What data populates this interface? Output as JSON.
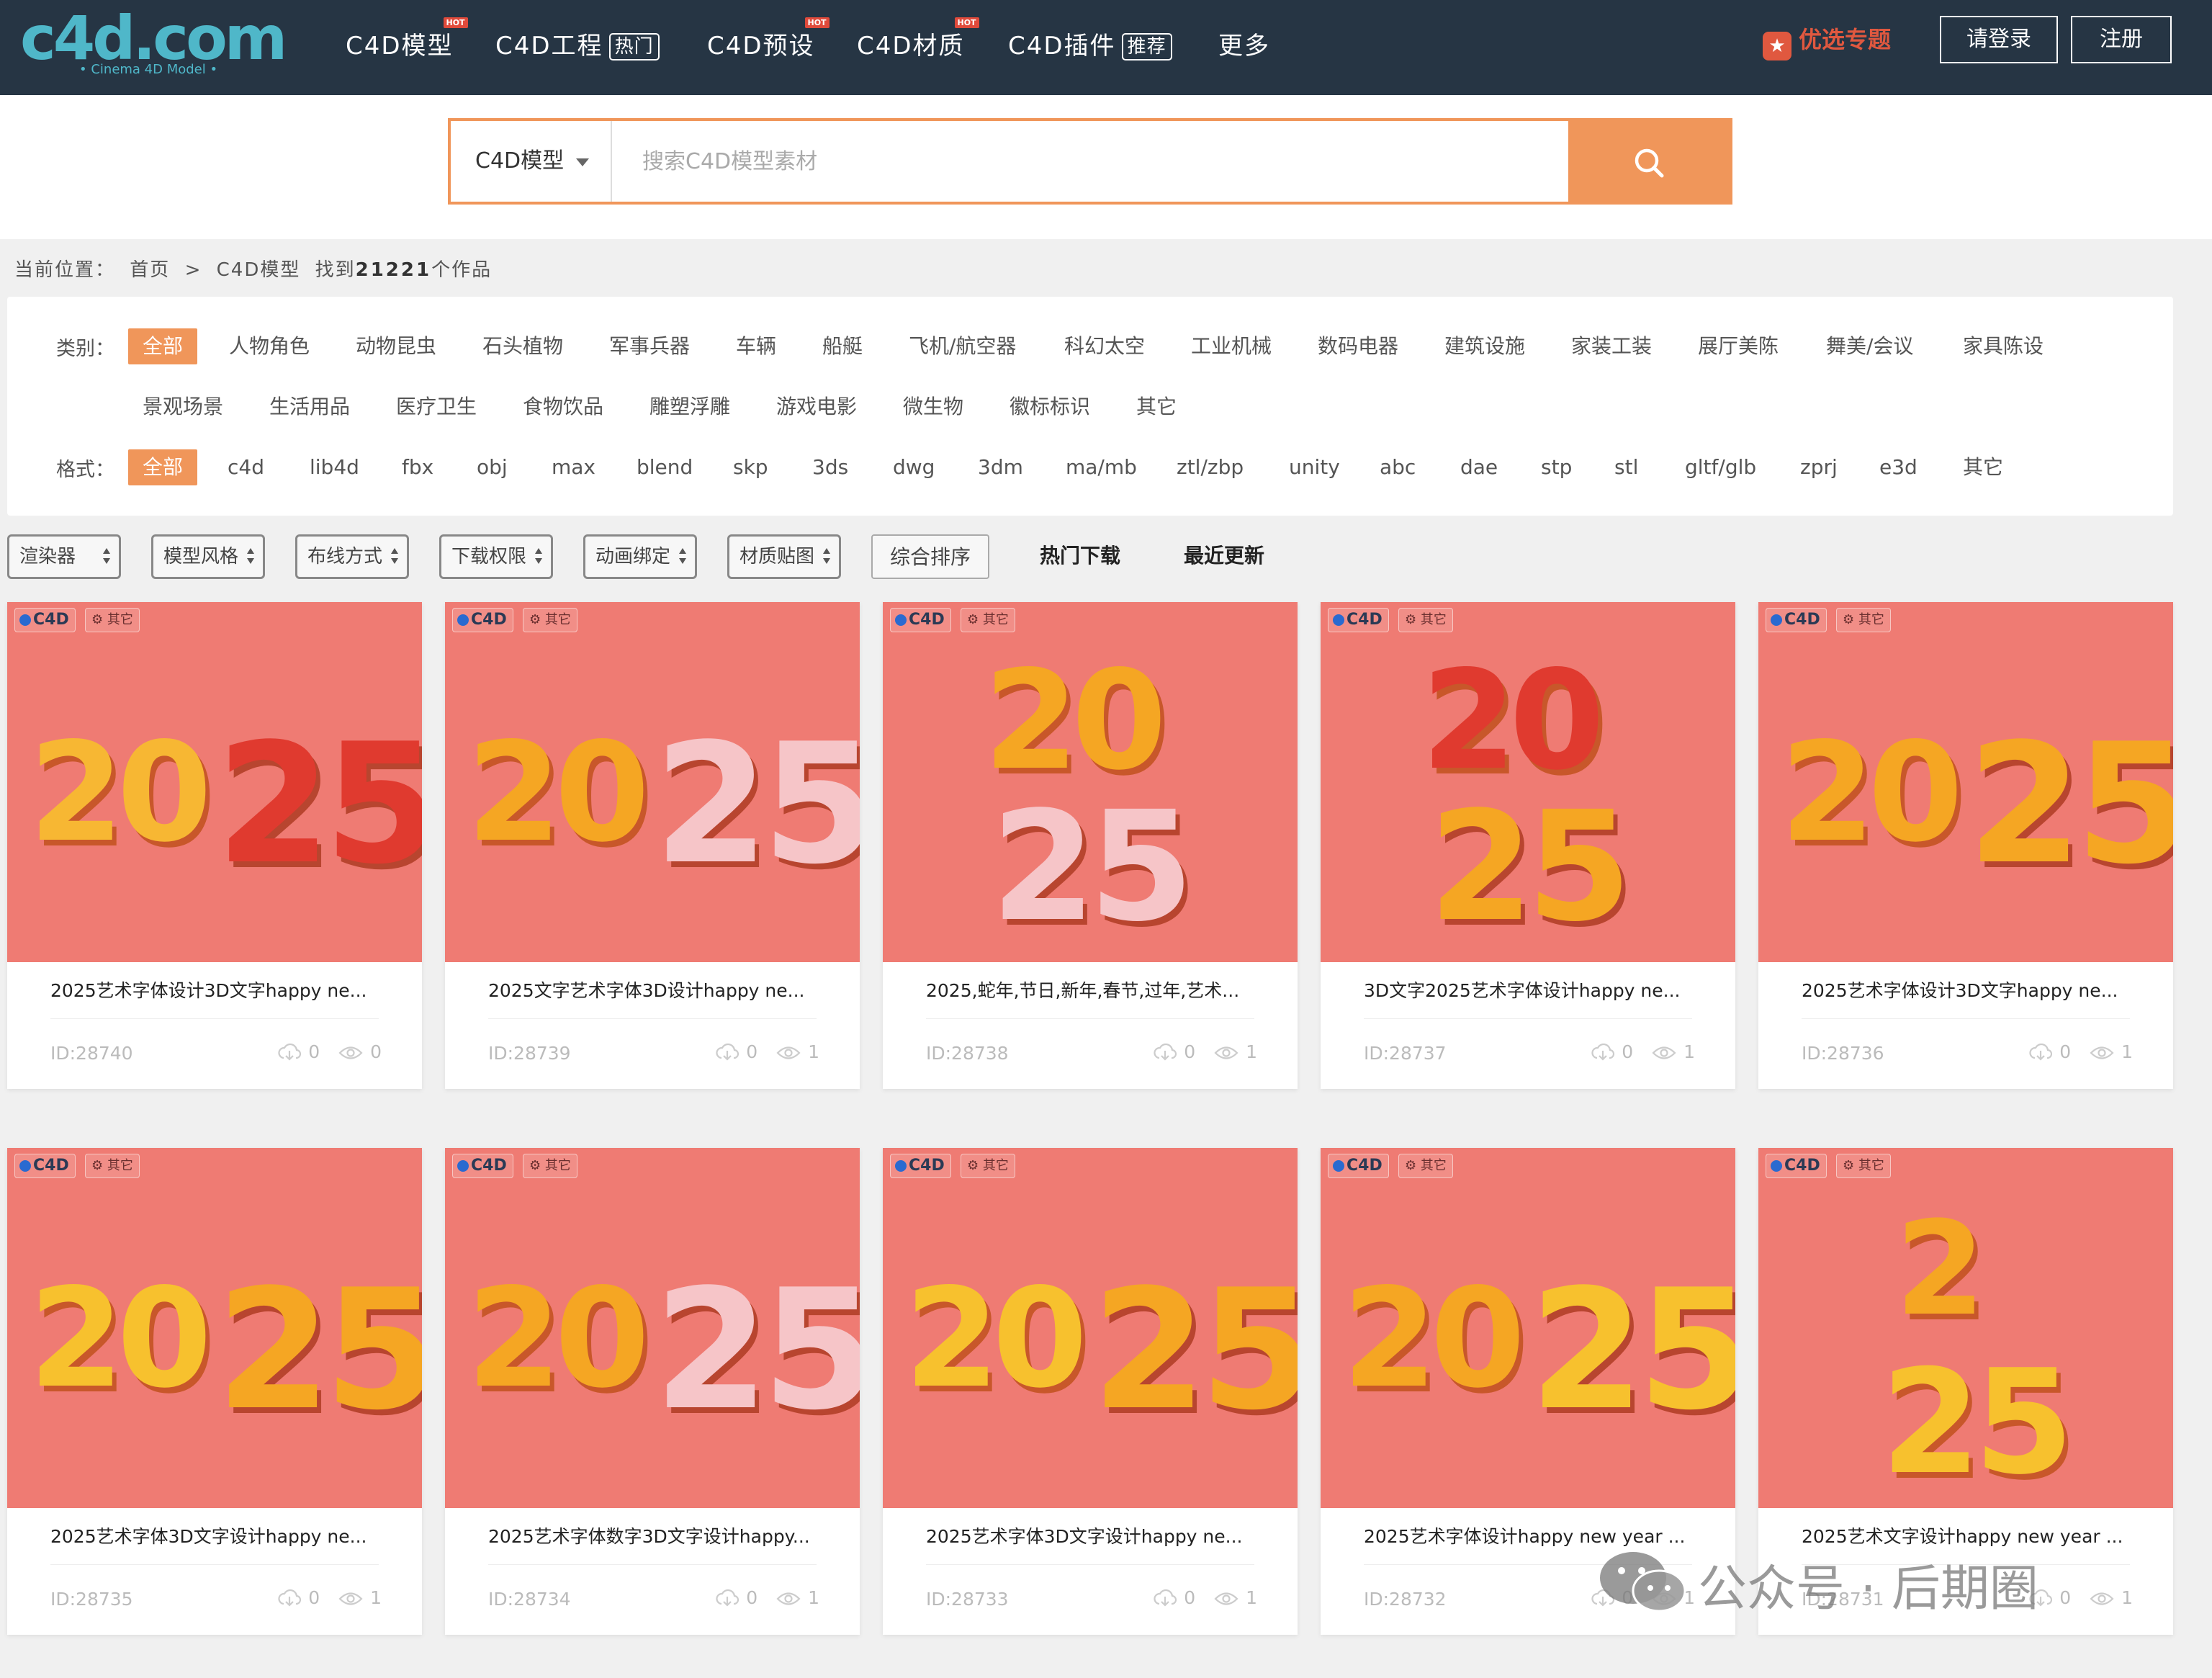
{
  "header": {
    "logo": "c4d.com",
    "logo_sub": "• Cinema 4D Model •",
    "nav": [
      {
        "label": "C4D模型",
        "tag": "",
        "hot": "HOT"
      },
      {
        "label": "C4D工程",
        "tag": "热门",
        "hot": ""
      },
      {
        "label": "C4D预设",
        "tag": "",
        "hot": "HOT"
      },
      {
        "label": "C4D材质",
        "tag": "",
        "hot": "HOT"
      },
      {
        "label": "C4D插件",
        "tag": "推荐",
        "hot": ""
      },
      {
        "label": "更多",
        "tag": "",
        "hot": ""
      }
    ],
    "special": "优选专题",
    "login": "请登录",
    "register": "注册"
  },
  "search": {
    "category": "C4D模型",
    "placeholder": "搜索C4D模型素材"
  },
  "breadcrumb": {
    "prefix": "当前位置：",
    "home": "首页",
    "sep": ">",
    "current": "C4D模型",
    "found_pre": "找到",
    "count": "21221",
    "found_post": "个作品"
  },
  "filters": {
    "category_label": "类别：",
    "categories_row1": [
      "全部",
      "人物角色",
      "动物昆虫",
      "石头植物",
      "军事兵器",
      "车辆",
      "船艇",
      "飞机/航空器",
      "科幻太空",
      "工业机械",
      "数码电器",
      "建筑设施",
      "家装工装",
      "展厅美陈",
      "舞美/会议",
      "家具陈设"
    ],
    "categories_row2": [
      "景观场景",
      "生活用品",
      "医疗卫生",
      "食物饮品",
      "雕塑浮雕",
      "游戏电影",
      "微生物",
      "徽标标识",
      "其它"
    ],
    "format_label": "格式：",
    "formats": [
      "全部",
      "c4d",
      "lib4d",
      "fbx",
      "obj",
      "max",
      "blend",
      "skp",
      "3ds",
      "dwg",
      "3dm",
      "ma/mb",
      "ztl/zbp",
      "unity",
      "abc",
      "dae",
      "stp",
      "stl",
      "gltf/glb",
      "zprj",
      "e3d",
      "其它"
    ]
  },
  "sortbar": {
    "selects": [
      "渲染器",
      "模型风格",
      "布线方式",
      "下载权限",
      "动画绑定",
      "材质贴图"
    ],
    "buttons": [
      "综合排序",
      "热门下载",
      "最近更新"
    ]
  },
  "cards": [
    {
      "title": "2025艺术字体设计3D文字happy ne...",
      "id": "ID:28740",
      "downloads": "0",
      "views": "0"
    },
    {
      "title": "2025文字艺术字体3D设计happy ne...",
      "id": "ID:28739",
      "downloads": "0",
      "views": "1"
    },
    {
      "title": "2025,蛇年,节日,新年,春节,过年,艺术...",
      "id": "ID:28738",
      "downloads": "0",
      "views": "1"
    },
    {
      "title": "3D文字2025艺术字体设计happy ne...",
      "id": "ID:28737",
      "downloads": "0",
      "views": "1"
    },
    {
      "title": "2025艺术字体设计3D文字happy ne...",
      "id": "ID:28736",
      "downloads": "0",
      "views": "1"
    },
    {
      "title": "2025艺术字体3D文字设计happy ne...",
      "id": "ID:28735",
      "downloads": "0",
      "views": "1"
    },
    {
      "title": "2025艺术字体数字3D文字设计happy...",
      "id": "ID:28734",
      "downloads": "0",
      "views": "1"
    },
    {
      "title": "2025艺术字体3D文字设计happy ne...",
      "id": "ID:28733",
      "downloads": "0",
      "views": "1"
    },
    {
      "title": "2025艺术字体设计happy new year ...",
      "id": "ID:28732",
      "downloads": "0",
      "views": "1"
    },
    {
      "title": "2025艺术文字设计happy new year ...",
      "id": "ID:28731",
      "downloads": "0",
      "views": "1"
    }
  ],
  "card_badges": {
    "format": "C4D",
    "renderer": "其它"
  },
  "colors": {
    "header_bg": "#263544",
    "accent": "#f0965a",
    "thumb_bg": "#ef7b73",
    "logo": "#4fb7c9"
  },
  "watermark": {
    "text": "公众号 · 后期圈"
  }
}
